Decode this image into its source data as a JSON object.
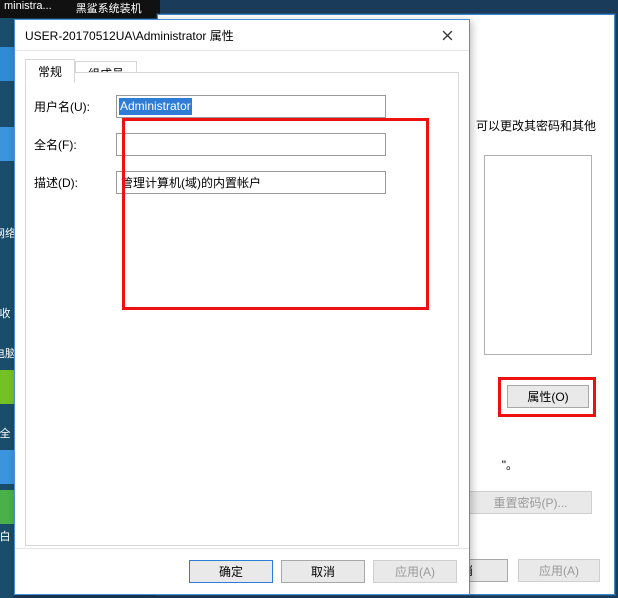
{
  "taskbar": {
    "item1": "ministra...",
    "item2": "黑鲨系统装机"
  },
  "desktop_labels": {
    "l1": "网络",
    "l2": "收",
    "l3": "电脑",
    "l4": "全",
    "l5": "白"
  },
  "parent": {
    "hint_text": "可以更改其密码和其他",
    "properties_btn": "属性(O)",
    "quote_tail": "\"。",
    "reset_btn": "重置密码(P)...",
    "cancel": "消",
    "apply": "应用(A)"
  },
  "dialog": {
    "title": "USER-20170512UA\\Administrator 属性",
    "tabs": {
      "general": "常规",
      "members": "组成员"
    },
    "fields": {
      "username_label": "用户名(U):",
      "username_value": "Administrator",
      "fullname_label": "全名(F):",
      "fullname_value": "",
      "description_label": "描述(D):",
      "description_value": "管理计算机(域)的内置帐户"
    },
    "buttons": {
      "ok": "确定",
      "cancel": "取消",
      "apply": "应用(A)"
    }
  }
}
